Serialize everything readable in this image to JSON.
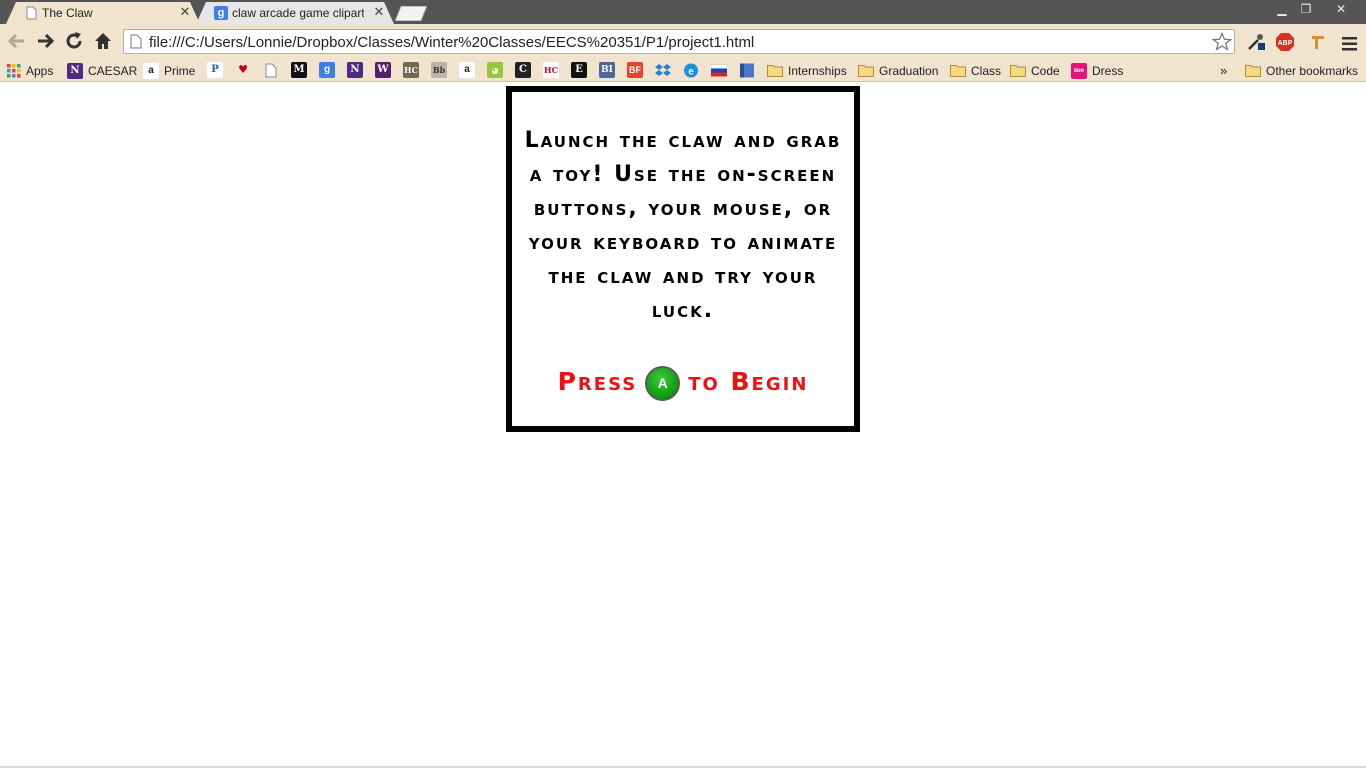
{
  "tabs": [
    {
      "title": "The Claw",
      "favicon": "page-icon",
      "active": true
    },
    {
      "title": "claw arcade game clipart -",
      "favicon": "google-icon",
      "active": false
    }
  ],
  "window_controls": {
    "minimize": "▁",
    "restore": "❐",
    "close": "✕"
  },
  "toolbar": {
    "url": "file:///C:/Users/Lonnie/Dropbox/Classes/Winter%20Classes/EECS%20351/P1/project1.html"
  },
  "bookmarks": [
    {
      "label": "Apps",
      "icon": "apps-grid-icon"
    },
    {
      "label": "CAESAR",
      "icon": "northwestern-n-icon"
    },
    {
      "label": "Prime",
      "icon": "amazon-icon"
    },
    {
      "label": "",
      "icon": "pandora-icon"
    },
    {
      "label": "",
      "icon": "iheart-icon"
    },
    {
      "label": "",
      "icon": "blank-page-icon"
    },
    {
      "label": "",
      "icon": "m-icon"
    },
    {
      "label": "",
      "icon": "google-icon"
    },
    {
      "label": "",
      "icon": "northwestern-n-icon"
    },
    {
      "label": "",
      "icon": "w-icon"
    },
    {
      "label": "",
      "icon": "hc-icon"
    },
    {
      "label": "",
      "icon": "blackboard-icon"
    },
    {
      "label": "",
      "icon": "amazon-icon"
    },
    {
      "label": "",
      "icon": "android-icon"
    },
    {
      "label": "",
      "icon": "c-icon"
    },
    {
      "label": "",
      "icon": "hc-red-icon"
    },
    {
      "label": "",
      "icon": "e-icon"
    },
    {
      "label": "",
      "icon": "bi-icon"
    },
    {
      "label": "",
      "icon": "bf-icon"
    },
    {
      "label": "",
      "icon": "dropbox-icon"
    },
    {
      "label": "",
      "icon": "ie-icon"
    },
    {
      "label": "",
      "icon": "flag-icon"
    },
    {
      "label": "",
      "icon": "blue-book-icon"
    },
    {
      "label": "Internships",
      "icon": "folder-icon"
    },
    {
      "label": "Graduation",
      "icon": "folder-icon"
    },
    {
      "label": "Class",
      "icon": "folder-icon"
    },
    {
      "label": "Code",
      "icon": "folder-icon"
    },
    {
      "label": "Dress",
      "icon": "pink-icon"
    }
  ],
  "bookmarks_overflow": "»",
  "other_bookmarks": "Other bookmarks",
  "game": {
    "instructions": "Launch the claw and grab a toy! Use the on-screen buttons, your mouse, or your keyboard to animate the claw and try your luck.",
    "begin_prefix": "Press",
    "button_label": "A",
    "begin_suffix": "to Begin",
    "colors": {
      "prompt": "#ee1111",
      "button": "#0a9a0a",
      "border": "#000000"
    }
  }
}
